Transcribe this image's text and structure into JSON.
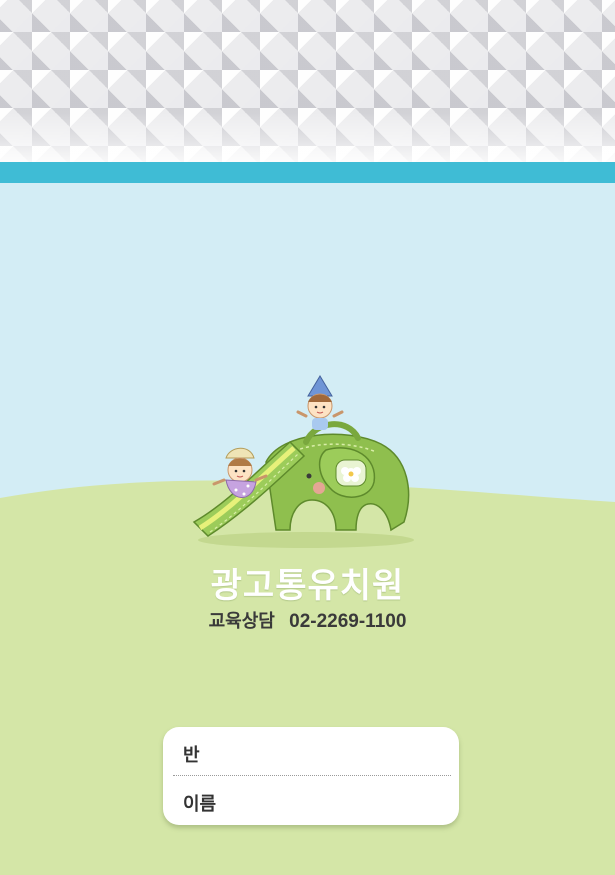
{
  "header": {
    "pattern": "white-pyramid-tiles",
    "stripe_color": "#3fbcd5"
  },
  "scene": {
    "sky_color": "#d3edf5",
    "ground_color": "#d4e6a7",
    "illustration": "elephant-slide-with-children"
  },
  "kindergarten": {
    "name": "광고통유치원",
    "contact_label": "교육상담",
    "phone": "02-2269-1100"
  },
  "form": {
    "class_label": "반",
    "name_label": "이름"
  }
}
